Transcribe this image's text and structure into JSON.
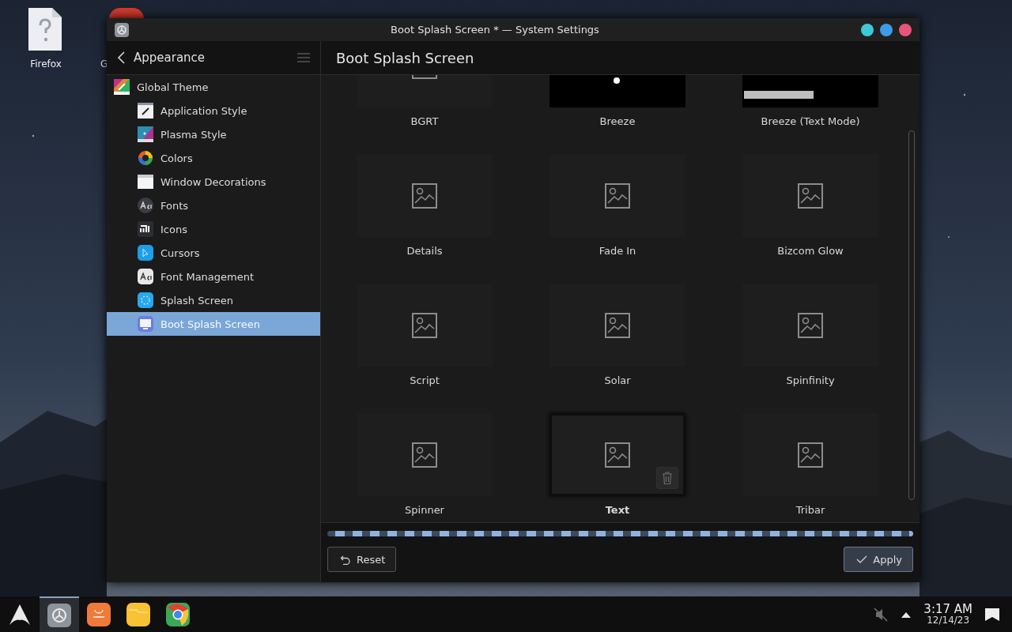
{
  "desktop": {
    "icons": [
      {
        "label": "Firefox",
        "kind": "unknown-file"
      },
      {
        "label": "G",
        "kind": "red-app"
      }
    ]
  },
  "window": {
    "title": "Boot Splash Screen * — System Settings",
    "controls": [
      {
        "color": "#3dc8d8"
      },
      {
        "color": "#3d9ce8"
      },
      {
        "color": "#e8557a"
      }
    ]
  },
  "sidebar": {
    "back_label": "Appearance",
    "items": [
      {
        "label": "Global Theme",
        "kind": "global-theme",
        "selected": false,
        "children": [
          {
            "label": "Application Style",
            "kind": "app-style",
            "selected": false
          },
          {
            "label": "Plasma Style",
            "kind": "plasma-style",
            "selected": false
          },
          {
            "label": "Colors",
            "kind": "colors",
            "selected": false
          },
          {
            "label": "Window Decorations",
            "kind": "window-decorations",
            "selected": false
          },
          {
            "label": "Fonts",
            "kind": "fonts",
            "selected": false
          },
          {
            "label": "Icons",
            "kind": "icons",
            "selected": false
          },
          {
            "label": "Cursors",
            "kind": "cursors",
            "selected": false
          },
          {
            "label": "Font Management",
            "kind": "font-management",
            "selected": false
          },
          {
            "label": "Splash Screen",
            "kind": "splash",
            "selected": false
          },
          {
            "label": "Boot Splash Screen",
            "kind": "boot-splash",
            "selected": true
          }
        ]
      }
    ]
  },
  "page": {
    "title": "Boot Splash Screen",
    "themes": [
      {
        "name": "BGRT",
        "kind": "placeholder",
        "selected": false,
        "deletable": false
      },
      {
        "name": "Breeze",
        "kind": "dot",
        "selected": false,
        "deletable": false
      },
      {
        "name": "Breeze (Text Mode)",
        "kind": "bar",
        "selected": false,
        "deletable": false
      },
      {
        "name": "Details",
        "kind": "placeholder",
        "selected": false,
        "deletable": false
      },
      {
        "name": "Fade In",
        "kind": "placeholder",
        "selected": false,
        "deletable": false
      },
      {
        "name": "Bizcom Glow",
        "kind": "placeholder",
        "selected": false,
        "deletable": false
      },
      {
        "name": "Script",
        "kind": "placeholder",
        "selected": false,
        "deletable": false
      },
      {
        "name": "Solar",
        "kind": "placeholder",
        "selected": false,
        "deletable": false
      },
      {
        "name": "Spinfinity",
        "kind": "placeholder",
        "selected": false,
        "deletable": false
      },
      {
        "name": "Spinner",
        "kind": "placeholder",
        "selected": false,
        "deletable": false
      },
      {
        "name": "Text",
        "kind": "placeholder",
        "selected": true,
        "deletable": true
      },
      {
        "name": "Tribar",
        "kind": "placeholder",
        "selected": false,
        "deletable": false
      }
    ]
  },
  "footer": {
    "busy": true,
    "buttons": [
      {
        "label": "Reset",
        "kind": "reset",
        "focused": false
      },
      {
        "label": "Apply",
        "kind": "apply",
        "focused": true
      }
    ]
  },
  "taskbar": {
    "apps": [
      {
        "kind": "launcher",
        "active": false
      },
      {
        "kind": "settings",
        "active": true
      },
      {
        "kind": "store",
        "active": false
      },
      {
        "kind": "files",
        "active": false
      },
      {
        "kind": "browser",
        "active": false
      }
    ],
    "tray": {
      "muted": true,
      "time": "3:17 AM",
      "date": "12/14/23"
    }
  }
}
